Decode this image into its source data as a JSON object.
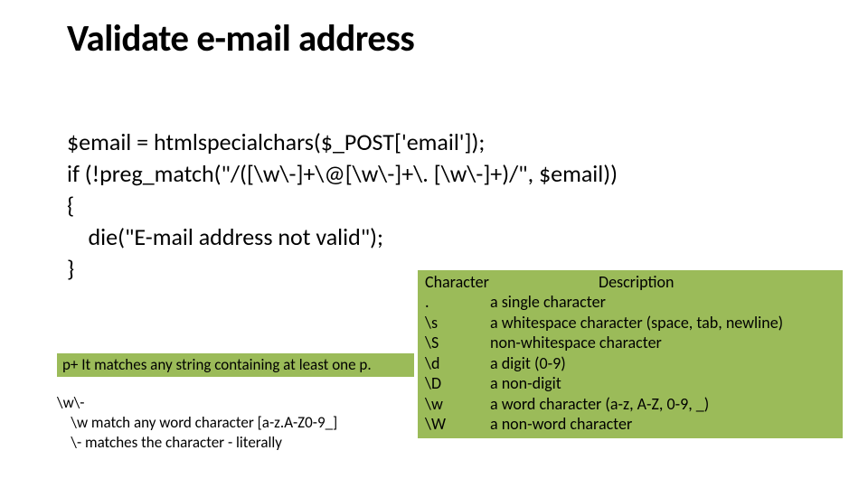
{
  "title": "Validate e-mail address",
  "code": {
    "l1": "$email = htmlspecialchars($_POST['email']);",
    "l2": "if (!preg_match(\"/([\\w\\-]+\\@[\\w\\-]+\\. [\\w\\-]+)/\", $email))",
    "l3": "{",
    "l4": "    die(\"E-mail address not valid\");",
    "l5": "}"
  },
  "left_notes": {
    "n1": "p+  It matches any string containing at least one p.",
    "n2_l1": "\\w\\-",
    "n2_l2": "    \\w match any word character [a-z.A-Z0-9_]",
    "n2_l3": "    \\- matches the character - literally"
  },
  "table": {
    "head": {
      "c1": "Character",
      "c2": "Description"
    },
    "rows": [
      {
        "c1": ".",
        "c2": "a single character"
      },
      {
        "c1": "\\s",
        "c2": "a whitespace character (space, tab, newline)"
      },
      {
        "c1": "\\S",
        "c2": "non-whitespace character"
      },
      {
        "c1": "\\d",
        "c2": "a digit (0-9)"
      },
      {
        "c1": "\\D",
        "c2": "a non-digit"
      },
      {
        "c1": "\\w",
        "c2": "a word character (a-z, A-Z, 0-9, _)"
      },
      {
        "c1": "\\W",
        "c2": "a non-word character"
      }
    ]
  }
}
